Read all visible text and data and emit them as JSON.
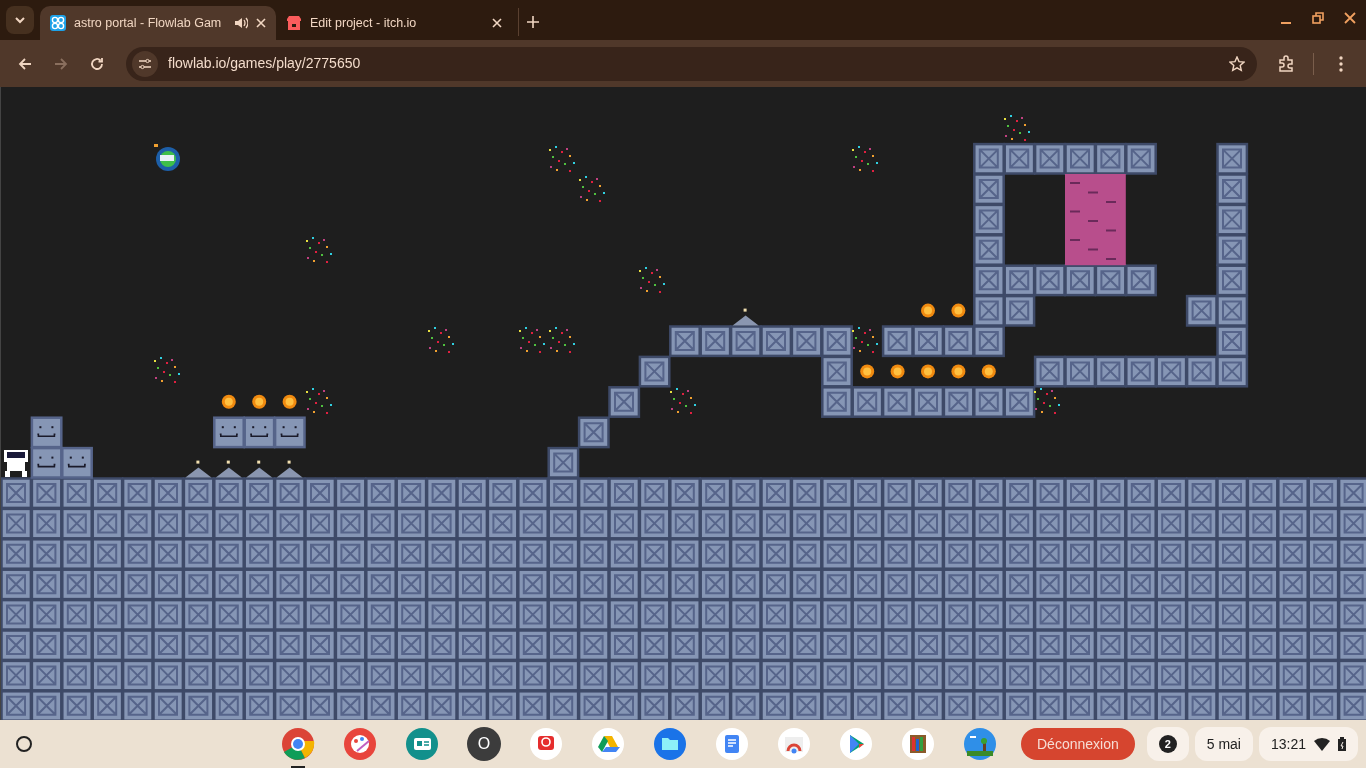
{
  "tabs": [
    {
      "title": "astro portal - Flowlab Gam",
      "kind": "rings",
      "selected": true,
      "audio": true
    },
    {
      "title": "Edit project - itch.io",
      "kind": "store",
      "selected": false,
      "audio": false
    }
  ],
  "toolbar": {
    "url": "flowlab.io/games/play/2775650",
    "back_disabled": false,
    "forward_disabled": true,
    "bookmarked": false
  },
  "shelf": {
    "apps": [
      {
        "kind": "chrome",
        "active": true
      },
      {
        "kind": "paint",
        "active": false
      },
      {
        "kind": "news",
        "active": false
      },
      {
        "kind": "letter",
        "glyph": "O",
        "active": false
      },
      {
        "kind": "camera",
        "active": false
      },
      {
        "kind": "drive",
        "active": false
      },
      {
        "kind": "files",
        "active": false
      },
      {
        "kind": "docs",
        "active": false
      },
      {
        "kind": "webstore",
        "active": false
      },
      {
        "kind": "play",
        "active": false
      },
      {
        "kind": "books",
        "active": false
      },
      {
        "kind": "game",
        "active": false
      }
    ],
    "logout_button": "Déconnexion",
    "notification_count": "2",
    "date": "5 mai",
    "time": "13:21"
  }
}
